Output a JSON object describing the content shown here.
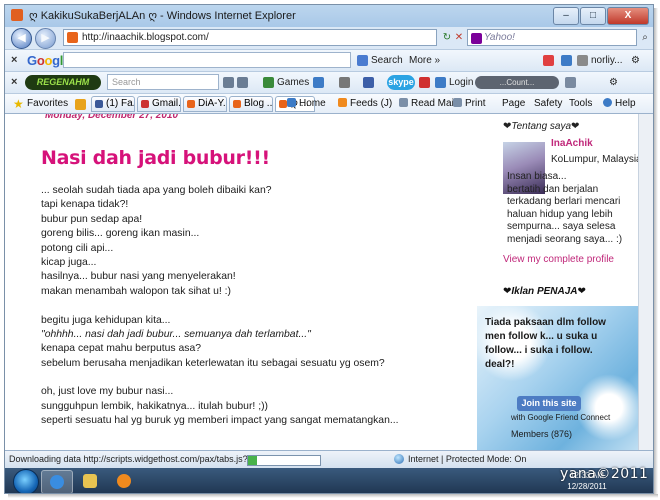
{
  "window": {
    "title": "ღ KakikuSukaBerjALAn ღ - Windows Internet Explorer",
    "minimize_glyph": "–",
    "maximize_glyph": "□",
    "close_glyph": "X"
  },
  "address_bar": {
    "url": "http://inaachik.blogspot.com/",
    "search_placeholder": "Yahoo!"
  },
  "google_toolbar": {
    "close_glyph": "×",
    "logo": "Google",
    "search_label": "Search",
    "more_label": "More »",
    "user": "norliy..."
  },
  "regen_toolbar": {
    "close_glyph": "×",
    "logo": "REGENAHM",
    "search_placeholder": "Search",
    "games_label": "Games",
    "skype_label": "skype",
    "login_label": "Login",
    "count_label": "...Count..."
  },
  "favorites_bar": {
    "favorites_label": "Favorites",
    "tabs": [
      {
        "label": "(1) Fa...",
        "color": "#3b5998"
      },
      {
        "label": "Gmail...",
        "color": "#cc3333"
      },
      {
        "label": "DiA-Y...",
        "color": "#e8641b"
      },
      {
        "label": "Blog ...",
        "color": "#e8641b"
      },
      {
        "label": "ღ ...",
        "color": "#e8641b"
      }
    ],
    "commands": [
      {
        "label": "Home",
        "color": "#3d7bc6"
      },
      {
        "label": "Feeds (J)",
        "color": "#f08a1e"
      },
      {
        "label": "Read Mail",
        "color": "#7b8fa8"
      },
      {
        "label": "Print",
        "color": "#7b8fa8"
      },
      {
        "label": "Page",
        "color": "#7b8fa8"
      },
      {
        "label": "Safety",
        "color": "#7b8fa8"
      },
      {
        "label": "Tools",
        "color": "#7b8fa8"
      },
      {
        "label": "Help",
        "color": "#3d7bc6"
      }
    ]
  },
  "post": {
    "date": "Monday, December 27, 2010",
    "title": "Nasi dah jadi bubur!!!",
    "lines": [
      "... seolah sudah tiada apa yang boleh dibaiki kan?",
      "tapi kenapa tidak?!",
      "bubur pun sedap apa!",
      "goreng bilis... goreng ikan masin...",
      "potong cili api...",
      "kicap juga...",
      "hasilnya... bubur nasi yang menyelerakan!",
      "makan menambah walopon tak sihat u! :)",
      "",
      "begitu juga kehidupan kita...",
      "\"ohhhh... nasi dah jadi bubur... semuanya dah terlambat...\"",
      "kenapa cepat mahu berputus asa?",
      "sebelum berusaha menjadikan keterlewatan itu sebagai sesuatu yg osem?",
      "",
      "oh, just love my bubur nasi...",
      "sungguhpun lembik, hakikatnya... itulah bubur! ;))",
      "seperti sesuatu hal yg buruk yg memberi impact yang sangat mematangkan..."
    ]
  },
  "sidebar": {
    "heading": "❤Tentang saya❤",
    "name": "InaAchik",
    "location": "KoLumpur, Malaysia",
    "bio_lines": [
      "Insan biasa...",
      "bertatih dan berjalan",
      "terkadang berlari mencari",
      "haluan hidup yang lebih",
      "sempurna... saya selesa",
      "menjadi seorang saya... :)"
    ],
    "profile_link": "View my complete profile",
    "ads_heading": "❤Iklan PENAJA❤",
    "ad_lines": [
      "Tiada paksaan dlm follow",
      "men follow k... u suka u",
      "follow... i suka i follow.",
      "deal?!"
    ],
    "join_label": "Join this site",
    "join_sub": "with Google Friend Connect",
    "members_label": "Members (876)"
  },
  "status_bar": {
    "text": "Downloading data http://scripts.widgethost.com/pax/tabs.js?tabs=ta",
    "progress": 0.12,
    "zone": "Internet | Protected Mode: On"
  },
  "taskbar": {
    "time": "12:33 AM",
    "date": "12/28/2011"
  },
  "watermark": "yana©2011"
}
